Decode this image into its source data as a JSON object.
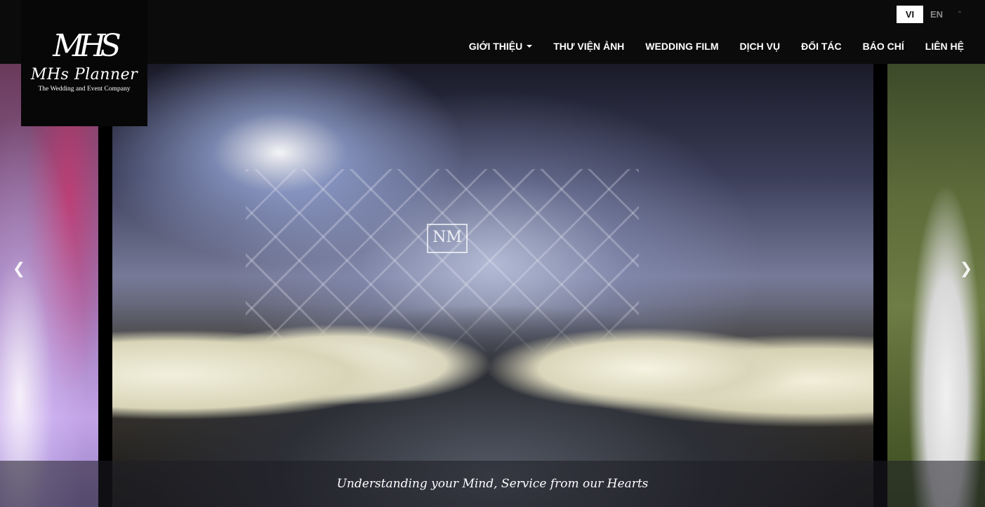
{
  "header": {
    "logo": {
      "monogram": "MHS",
      "name": "MHs Planner",
      "tagline": "The Wedding and Event Company"
    },
    "languages": [
      {
        "label": "VI",
        "active": true
      },
      {
        "label": "EN",
        "active": false
      }
    ],
    "language_toggle_icon": "chevron-up-icon",
    "nav": [
      {
        "label": "GIỚI THIỆU",
        "dropdown": true
      },
      {
        "label": "THƯ VIỆN ẢNH"
      },
      {
        "label": "WEDDING FILM"
      },
      {
        "label": "DỊCH VỤ"
      },
      {
        "label": "ĐỐI TÁC"
      },
      {
        "label": "BÁO CHÍ"
      },
      {
        "label": "LIÊN HỆ"
      }
    ]
  },
  "slider": {
    "stage_monogram": "NM",
    "caption": "Understanding your Mind, Service from our Hearts",
    "prev_icon": "chevron-left-icon",
    "next_icon": "chevron-right-icon"
  },
  "colors": {
    "header_bg": "#0b0b0b",
    "active_lang_bg": "#ffffff",
    "text": "#ffffff"
  }
}
